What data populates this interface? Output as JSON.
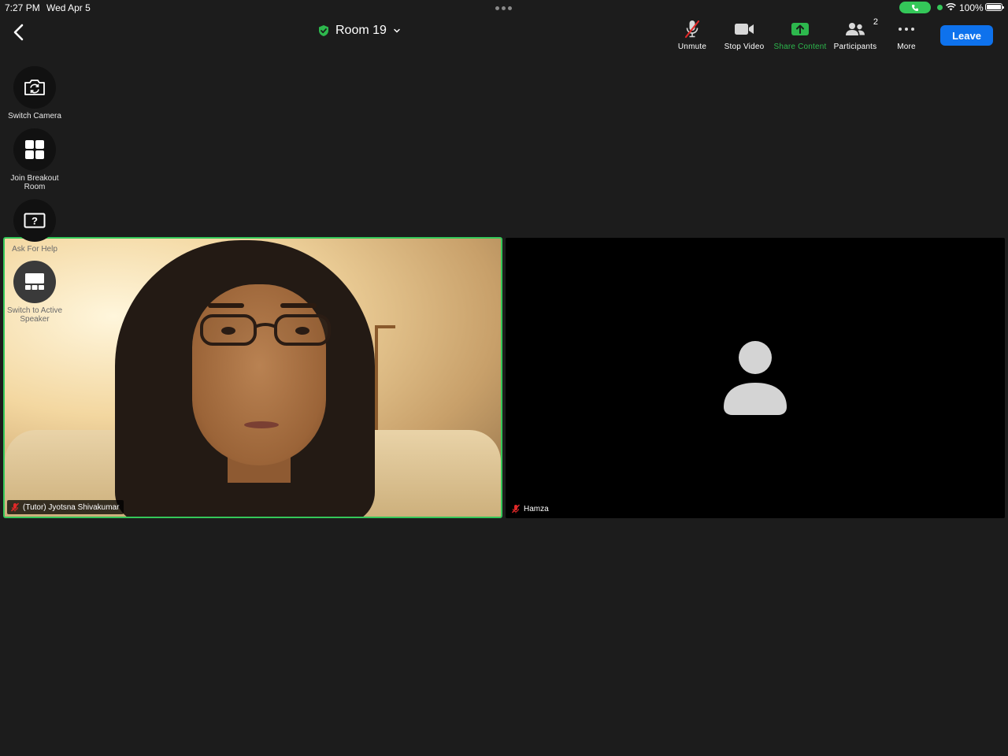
{
  "status_bar": {
    "time": "7:27 PM",
    "date": "Wed Apr 5",
    "battery": "100%"
  },
  "header": {
    "room_title": "Room 19",
    "tools": [
      {
        "label": "Unmute",
        "icon": "mic-muted-icon"
      },
      {
        "label": "Stop Video",
        "icon": "video-camera-icon"
      },
      {
        "label": "Share Content",
        "icon": "share-arrow-icon"
      },
      {
        "label": "Participants",
        "icon": "participants-icon",
        "count": "2"
      },
      {
        "label": "More",
        "icon": "more-dots-icon"
      }
    ],
    "leave_label": "Leave"
  },
  "side_actions": [
    {
      "label": "Switch Camera",
      "icon": "switch-camera-icon"
    },
    {
      "label": "Join Breakout Room",
      "icon": "breakout-grid-icon"
    },
    {
      "label": "Ask For Help",
      "icon": "ask-help-icon"
    },
    {
      "label": "Switch to Active Speaker",
      "icon": "active-speaker-icon"
    }
  ],
  "participants": [
    {
      "name": "(Tutor) Jyotsna Shivakumar",
      "muted": true,
      "video_on": true,
      "active": true
    },
    {
      "name": "Hamza",
      "muted": true,
      "video_on": false,
      "active": false
    }
  ],
  "colors": {
    "accent_green": "#34c759",
    "leave_blue": "#0e72ed",
    "muted_red": "#e02828"
  }
}
